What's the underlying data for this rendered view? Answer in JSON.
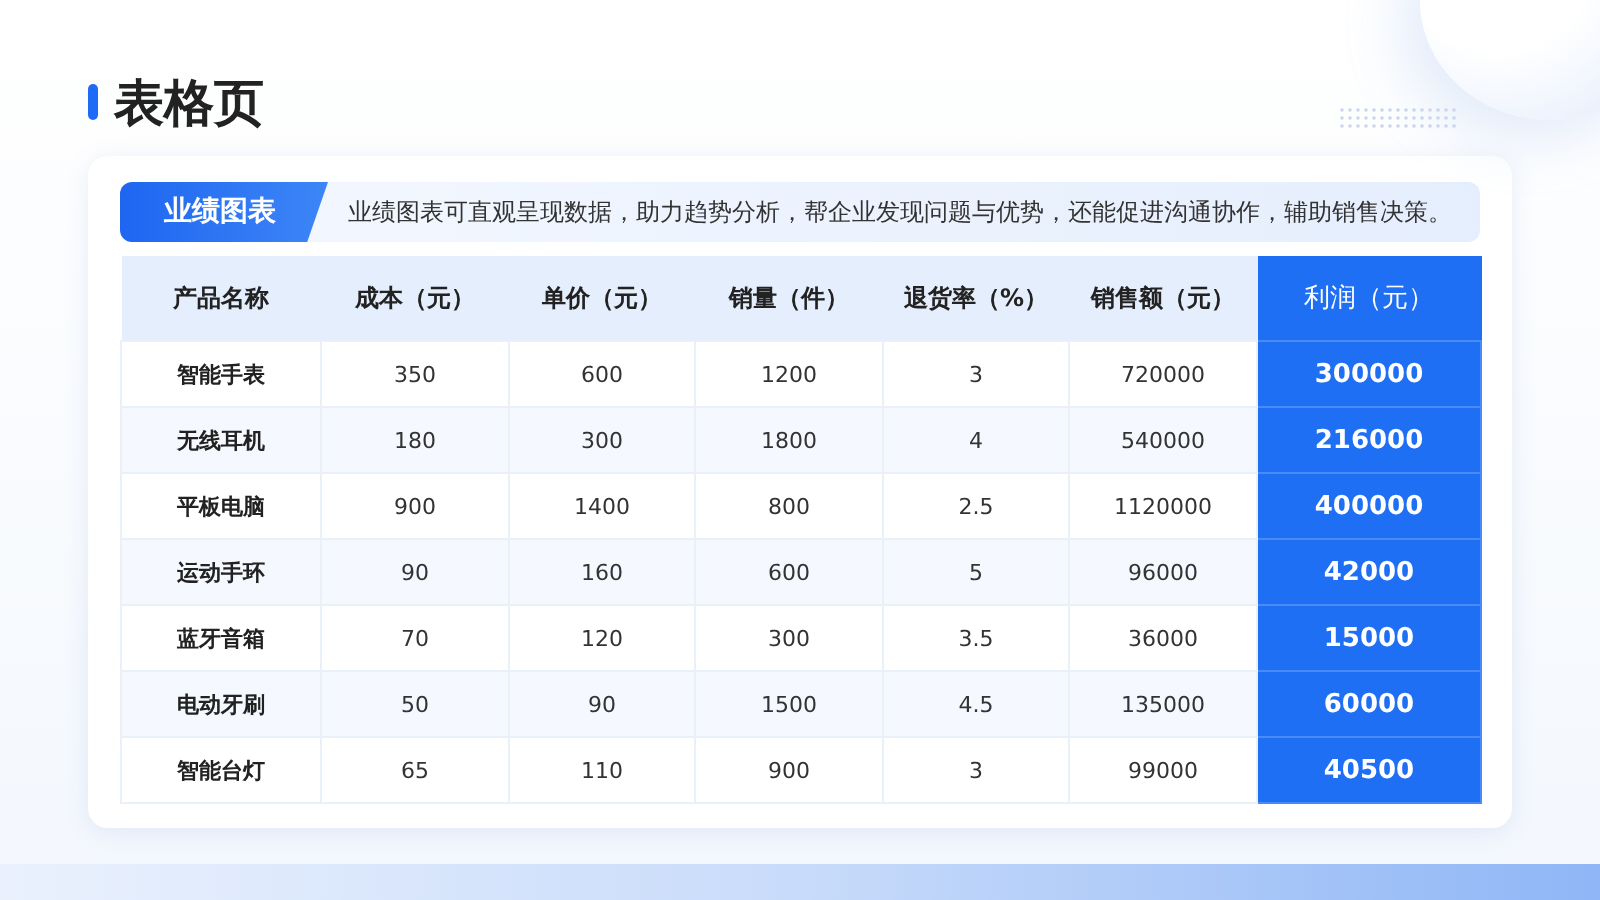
{
  "page_title": "表格页",
  "banner": {
    "tag": "业绩图表",
    "text": "业绩图表可直观呈现数据，助力趋势分析，帮企业发现问题与优势，还能促进沟通协作，辅助销售决策。"
  },
  "table": {
    "columns": [
      {
        "label": "产品名称",
        "highlighted": false
      },
      {
        "label": "成本（元）",
        "highlighted": false
      },
      {
        "label": "单价（元）",
        "highlighted": false
      },
      {
        "label": "销量（件）",
        "highlighted": false
      },
      {
        "label": "退货率（%）",
        "highlighted": false
      },
      {
        "label": "销售额（元）",
        "highlighted": false
      },
      {
        "label": "利润（元）",
        "highlighted": true
      }
    ],
    "rows": [
      [
        "智能手表",
        "350",
        "600",
        "1200",
        "3",
        "720000",
        "300000"
      ],
      [
        "无线耳机",
        "180",
        "300",
        "1800",
        "4",
        "540000",
        "216000"
      ],
      [
        "平板电脑",
        "900",
        "1400",
        "800",
        "2.5",
        "1120000",
        "400000"
      ],
      [
        "运动手环",
        "90",
        "160",
        "600",
        "5",
        "96000",
        "42000"
      ],
      [
        "蓝牙音箱",
        "70",
        "120",
        "300",
        "3.5",
        "36000",
        "15000"
      ],
      [
        "电动牙刷",
        "50",
        "90",
        "1500",
        "4.5",
        "135000",
        "60000"
      ],
      [
        "智能台灯",
        "65",
        "110",
        "900",
        "3",
        "99000",
        "40500"
      ]
    ]
  }
}
